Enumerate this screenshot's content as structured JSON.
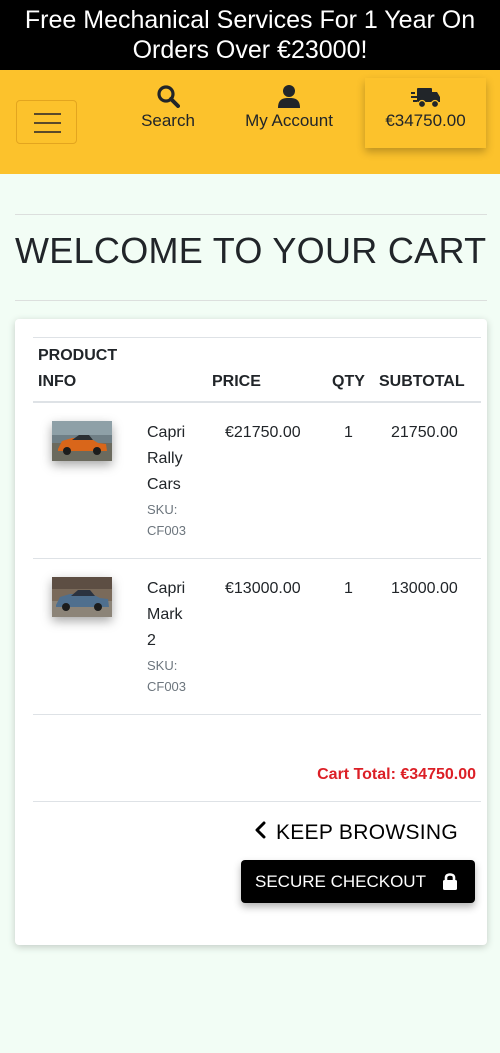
{
  "banner": {
    "line1": "Free Mechanical Services For 1 Year On",
    "line2": "Orders Over €23000!"
  },
  "header": {
    "search_label": "Search",
    "account_label": "My Account",
    "cart_total": "€34750.00"
  },
  "page": {
    "title": "WELCOME TO YOUR CART"
  },
  "table": {
    "headers": {
      "product_line1": "PRODUCT",
      "product_line2": "INFO",
      "price": "PRICE",
      "qty": "QTY",
      "subtotal": "SUBTOTAL"
    },
    "rows": [
      {
        "name_lines": [
          "Capri",
          "Rally",
          "Cars"
        ],
        "sku_label": "SKU:",
        "sku": "CF003",
        "price": "€21750.00",
        "qty": "1",
        "subtotal": "21750.00"
      },
      {
        "name_lines": [
          "Capri",
          "Mark",
          "2"
        ],
        "sku_label": "SKU:",
        "sku": "CF003",
        "price": "€13000.00",
        "qty": "1",
        "subtotal": "13000.00"
      }
    ]
  },
  "summary": {
    "cart_total": "Cart Total: €34750.00",
    "keep_browsing": "KEEP BROWSING",
    "checkout": "SECURE CHECKOUT"
  },
  "colors": {
    "banner_bg": "#000000",
    "header_bg": "#fcc22c",
    "page_bg": "#f2fdf5",
    "total_red": "#dc1f26"
  },
  "icons": {
    "search": "search-icon",
    "account": "user-icon",
    "cart": "shipping-truck-icon",
    "menu": "hamburger-menu-icon",
    "back": "chevron-left-icon",
    "checkout": "lock-icon"
  }
}
